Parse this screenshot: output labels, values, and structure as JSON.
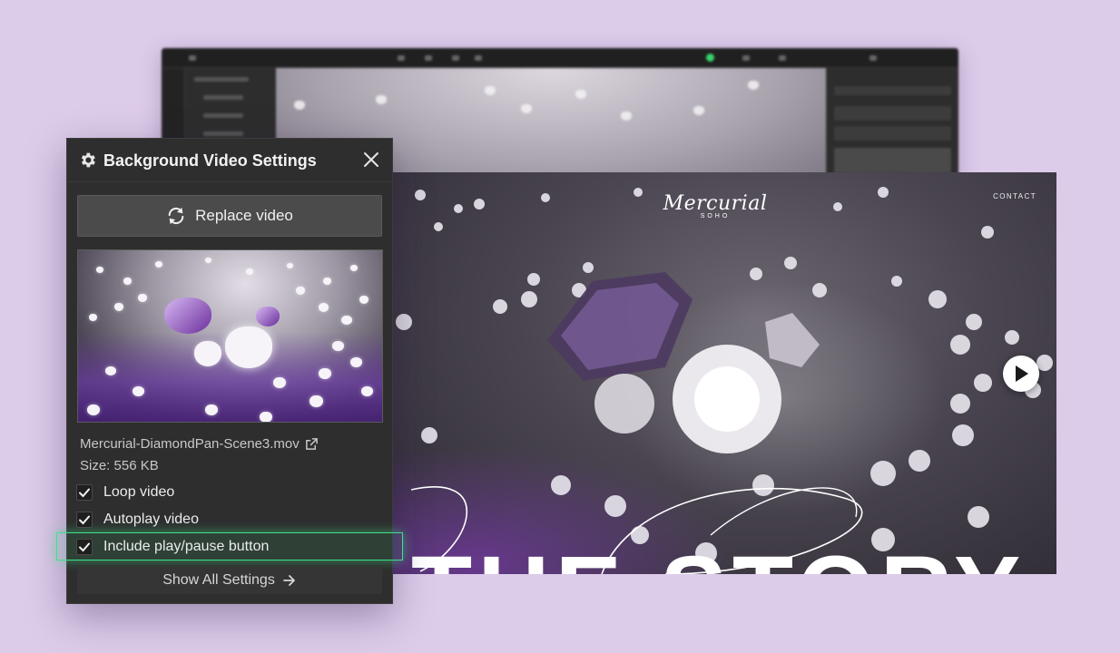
{
  "panel": {
    "title": "Background Video Settings",
    "replace_label": "Replace video",
    "file_name": "Mercurial-DiamondPan-Scene3.mov",
    "file_size": "Size: 556 KB",
    "options": [
      {
        "label": "Loop video",
        "checked": true
      },
      {
        "label": "Autoplay video",
        "checked": true
      },
      {
        "label": "Include play/pause button",
        "checked": true
      }
    ],
    "show_all_label": "Show All Settings"
  },
  "preview": {
    "logo_name": "Mercurial",
    "logo_sub": "SOHO",
    "nav_contact": "CONTACT",
    "heading": "THE STORY"
  },
  "colors": {
    "page_background": "#dccbe9",
    "panel_background": "#2e2e2e",
    "highlight": "#3fe08a"
  },
  "icons": {
    "settings": "gear-icon",
    "close": "close-icon",
    "replace": "refresh-icon",
    "external_link": "external-link-icon",
    "check": "check-icon",
    "arrow": "arrow-right-icon",
    "play": "play-icon"
  }
}
